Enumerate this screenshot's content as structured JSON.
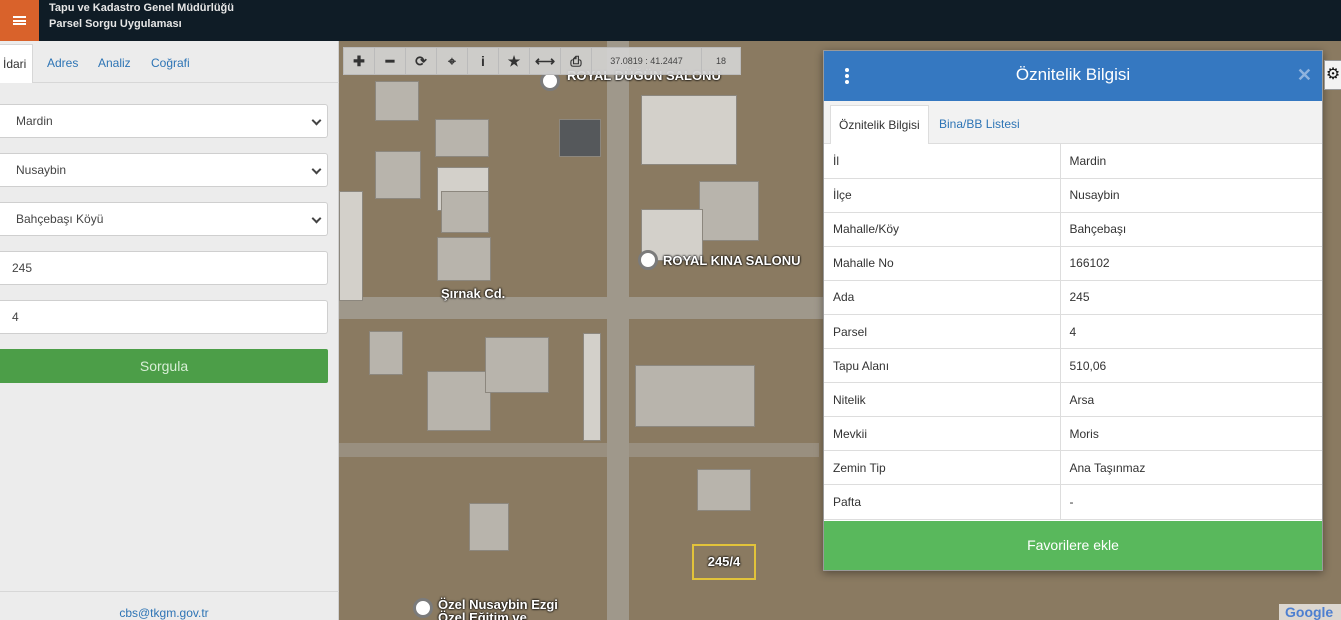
{
  "header": {
    "org": "Tapu ve Kadastro Genel Müdürlüğü",
    "app": "Parsel Sorgu Uygulaması",
    "menu_icon": "hamburger-icon"
  },
  "left_panel": {
    "tabs": [
      {
        "label": "İdari",
        "active": true
      },
      {
        "label": "Adres"
      },
      {
        "label": "Analiz"
      },
      {
        "label": "Coğrafi"
      }
    ],
    "il": "Mardin",
    "ilce": "Nusaybin",
    "mahalle": "Bahçebaşı Köyü",
    "ada": "245",
    "parsel": "4",
    "button": "Sorgula",
    "footer_email": "cbs@tkgm.gov.tr"
  },
  "toolbar": {
    "buttons": [
      "plus-icon",
      "minus-icon",
      "refresh-icon",
      "crosshair-icon",
      "info-icon",
      "star-icon",
      "measure-icon",
      "print-icon"
    ],
    "coordinates": "37.0819 : 41.2447",
    "zoom": "18"
  },
  "map": {
    "labels": {
      "royal_dugun": "ROYAL DÜĞÜN SALONU",
      "royal_kina": "ROYAL KINA SALONU",
      "street": "Şırnak Cd.",
      "school": "Özel Nusaybin Ezgi Özel Eğitim ve",
      "parcel": "245/4",
      "google": "Google"
    }
  },
  "dialog": {
    "title": "Öznitelik Bilgisi",
    "tabs": [
      "Öznitelik Bilgisi",
      "Bina/BB Listesi"
    ],
    "rows": [
      {
        "key": "İl",
        "value": "Mardin"
      },
      {
        "key": "İlçe",
        "value": "Nusaybin"
      },
      {
        "key": "Mahalle/Köy",
        "value": "Bahçebaşı"
      },
      {
        "key": "Mahalle No",
        "value": "166102"
      },
      {
        "key": "Ada",
        "value": "245"
      },
      {
        "key": "Parsel",
        "value": "4"
      },
      {
        "key": "Tapu Alanı",
        "value": "510,06"
      },
      {
        "key": "Nitelik",
        "value": "Arsa"
      },
      {
        "key": "Mevkii",
        "value": "Moris"
      },
      {
        "key": "Zemin Tip",
        "value": "Ana Taşınmaz"
      },
      {
        "key": "Pafta",
        "value": "-"
      }
    ],
    "favorite_button": "Favorilere ekle",
    "close_icon": "close-icon",
    "more_icon": "more-vertical-icon"
  },
  "colors": {
    "header_bg": "#0f1c26",
    "menu_accent": "#d9622b",
    "dialog_header": "#3578c1",
    "primary_green": "#4c9e48",
    "favorite_green": "#59b85c",
    "link_blue": "#2d74b5"
  }
}
